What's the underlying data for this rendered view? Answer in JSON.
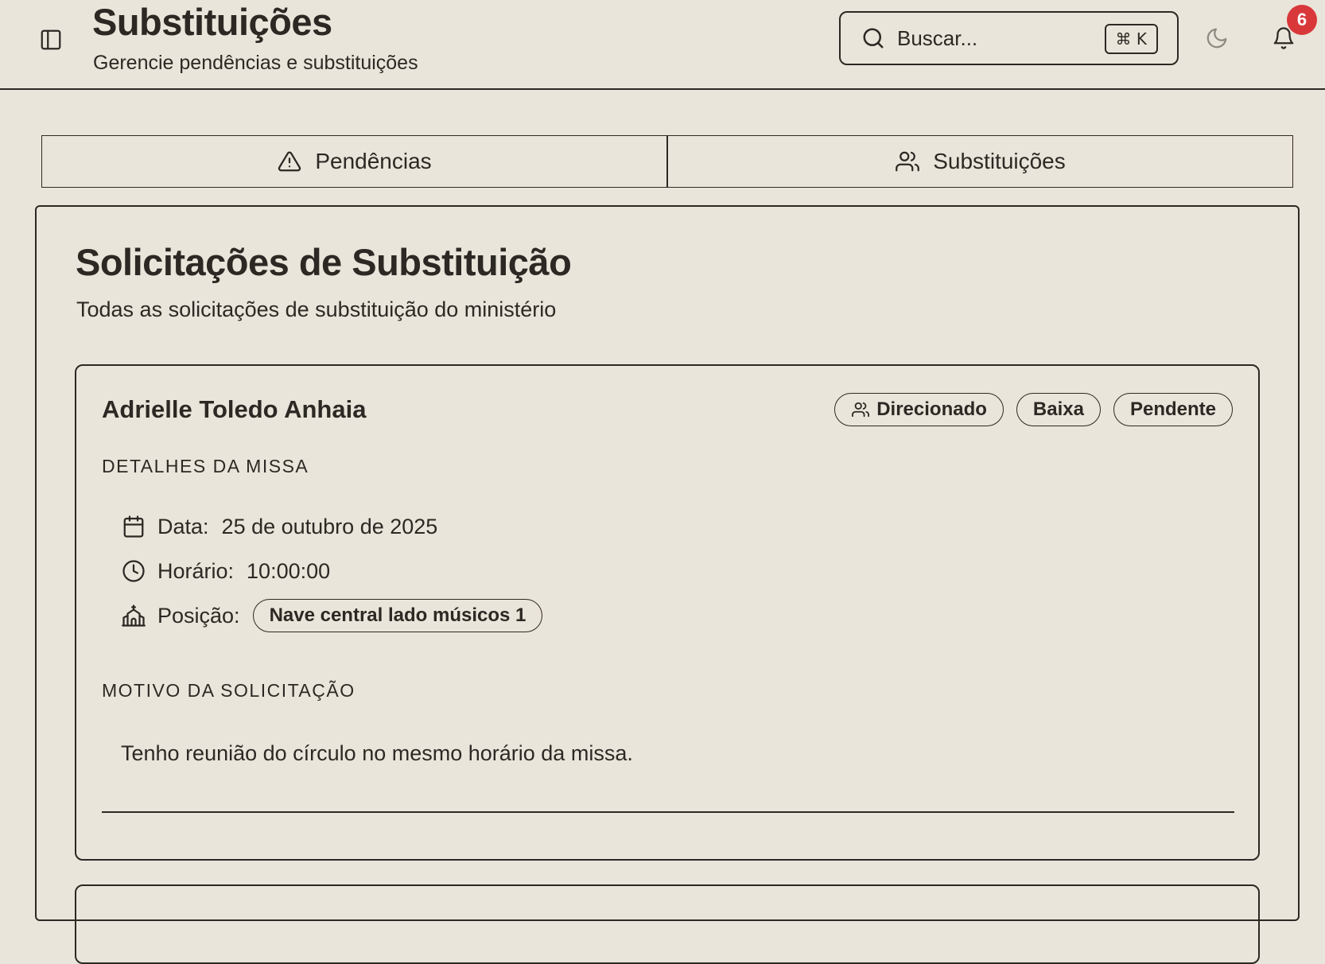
{
  "header": {
    "title": "Substituições",
    "subtitle": "Gerencie pendências e substituições",
    "search": {
      "placeholder": "Buscar...",
      "shortcut": "⌘ K"
    },
    "notifications": {
      "count": "6",
      "badge_color": "#d9383b"
    },
    "icons": {
      "sidebar_toggle": "sidebar-icon",
      "search": "search-icon",
      "theme": "moon-icon",
      "notifications": "bell-icon"
    }
  },
  "tabs": [
    {
      "label": "Pendências",
      "icon": "alert-triangle-icon"
    },
    {
      "label": "Substituições",
      "icon": "users-icon"
    }
  ],
  "main": {
    "title": "Solicitações de Substituição",
    "subtitle": "Todas as solicitações de substituição do ministério",
    "requests": [
      {
        "name": "Adrielle Toledo Anhaia",
        "badges": [
          {
            "label": "Direcionado",
            "icon": "users-icon"
          },
          {
            "label": "Baixa"
          },
          {
            "label": "Pendente"
          }
        ],
        "mass_details_label": "DETALHES DA MISSA",
        "date_label": "Data:",
        "date_value": "25 de outubro de 2025",
        "time_label": "Horário:",
        "time_value": "10:00:00",
        "position_label": "Posição:",
        "position_value": "Nave central lado músicos 1",
        "reason_label": "MOTIVO DA SOLICITAÇÃO",
        "reason_text": "Tenho reunião do círculo no mesmo horário da missa."
      }
    ]
  },
  "theme": {
    "background": "#eae5da",
    "foreground": "#2c2924"
  }
}
